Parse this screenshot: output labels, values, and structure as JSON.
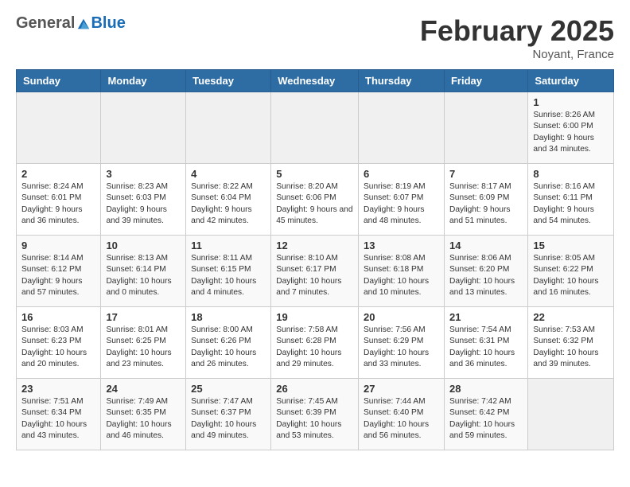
{
  "header": {
    "logo_general": "General",
    "logo_blue": "Blue",
    "month_title": "February 2025",
    "location": "Noyant, France"
  },
  "days_of_week": [
    "Sunday",
    "Monday",
    "Tuesday",
    "Wednesday",
    "Thursday",
    "Friday",
    "Saturday"
  ],
  "weeks": [
    [
      {
        "day": "",
        "info": ""
      },
      {
        "day": "",
        "info": ""
      },
      {
        "day": "",
        "info": ""
      },
      {
        "day": "",
        "info": ""
      },
      {
        "day": "",
        "info": ""
      },
      {
        "day": "",
        "info": ""
      },
      {
        "day": "1",
        "info": "Sunrise: 8:26 AM\nSunset: 6:00 PM\nDaylight: 9 hours and 34 minutes."
      }
    ],
    [
      {
        "day": "2",
        "info": "Sunrise: 8:24 AM\nSunset: 6:01 PM\nDaylight: 9 hours and 36 minutes."
      },
      {
        "day": "3",
        "info": "Sunrise: 8:23 AM\nSunset: 6:03 PM\nDaylight: 9 hours and 39 minutes."
      },
      {
        "day": "4",
        "info": "Sunrise: 8:22 AM\nSunset: 6:04 PM\nDaylight: 9 hours and 42 minutes."
      },
      {
        "day": "5",
        "info": "Sunrise: 8:20 AM\nSunset: 6:06 PM\nDaylight: 9 hours and 45 minutes."
      },
      {
        "day": "6",
        "info": "Sunrise: 8:19 AM\nSunset: 6:07 PM\nDaylight: 9 hours and 48 minutes."
      },
      {
        "day": "7",
        "info": "Sunrise: 8:17 AM\nSunset: 6:09 PM\nDaylight: 9 hours and 51 minutes."
      },
      {
        "day": "8",
        "info": "Sunrise: 8:16 AM\nSunset: 6:11 PM\nDaylight: 9 hours and 54 minutes."
      }
    ],
    [
      {
        "day": "9",
        "info": "Sunrise: 8:14 AM\nSunset: 6:12 PM\nDaylight: 9 hours and 57 minutes."
      },
      {
        "day": "10",
        "info": "Sunrise: 8:13 AM\nSunset: 6:14 PM\nDaylight: 10 hours and 0 minutes."
      },
      {
        "day": "11",
        "info": "Sunrise: 8:11 AM\nSunset: 6:15 PM\nDaylight: 10 hours and 4 minutes."
      },
      {
        "day": "12",
        "info": "Sunrise: 8:10 AM\nSunset: 6:17 PM\nDaylight: 10 hours and 7 minutes."
      },
      {
        "day": "13",
        "info": "Sunrise: 8:08 AM\nSunset: 6:18 PM\nDaylight: 10 hours and 10 minutes."
      },
      {
        "day": "14",
        "info": "Sunrise: 8:06 AM\nSunset: 6:20 PM\nDaylight: 10 hours and 13 minutes."
      },
      {
        "day": "15",
        "info": "Sunrise: 8:05 AM\nSunset: 6:22 PM\nDaylight: 10 hours and 16 minutes."
      }
    ],
    [
      {
        "day": "16",
        "info": "Sunrise: 8:03 AM\nSunset: 6:23 PM\nDaylight: 10 hours and 20 minutes."
      },
      {
        "day": "17",
        "info": "Sunrise: 8:01 AM\nSunset: 6:25 PM\nDaylight: 10 hours and 23 minutes."
      },
      {
        "day": "18",
        "info": "Sunrise: 8:00 AM\nSunset: 6:26 PM\nDaylight: 10 hours and 26 minutes."
      },
      {
        "day": "19",
        "info": "Sunrise: 7:58 AM\nSunset: 6:28 PM\nDaylight: 10 hours and 29 minutes."
      },
      {
        "day": "20",
        "info": "Sunrise: 7:56 AM\nSunset: 6:29 PM\nDaylight: 10 hours and 33 minutes."
      },
      {
        "day": "21",
        "info": "Sunrise: 7:54 AM\nSunset: 6:31 PM\nDaylight: 10 hours and 36 minutes."
      },
      {
        "day": "22",
        "info": "Sunrise: 7:53 AM\nSunset: 6:32 PM\nDaylight: 10 hours and 39 minutes."
      }
    ],
    [
      {
        "day": "23",
        "info": "Sunrise: 7:51 AM\nSunset: 6:34 PM\nDaylight: 10 hours and 43 minutes."
      },
      {
        "day": "24",
        "info": "Sunrise: 7:49 AM\nSunset: 6:35 PM\nDaylight: 10 hours and 46 minutes."
      },
      {
        "day": "25",
        "info": "Sunrise: 7:47 AM\nSunset: 6:37 PM\nDaylight: 10 hours and 49 minutes."
      },
      {
        "day": "26",
        "info": "Sunrise: 7:45 AM\nSunset: 6:39 PM\nDaylight: 10 hours and 53 minutes."
      },
      {
        "day": "27",
        "info": "Sunrise: 7:44 AM\nSunset: 6:40 PM\nDaylight: 10 hours and 56 minutes."
      },
      {
        "day": "28",
        "info": "Sunrise: 7:42 AM\nSunset: 6:42 PM\nDaylight: 10 hours and 59 minutes."
      },
      {
        "day": "",
        "info": ""
      }
    ]
  ]
}
